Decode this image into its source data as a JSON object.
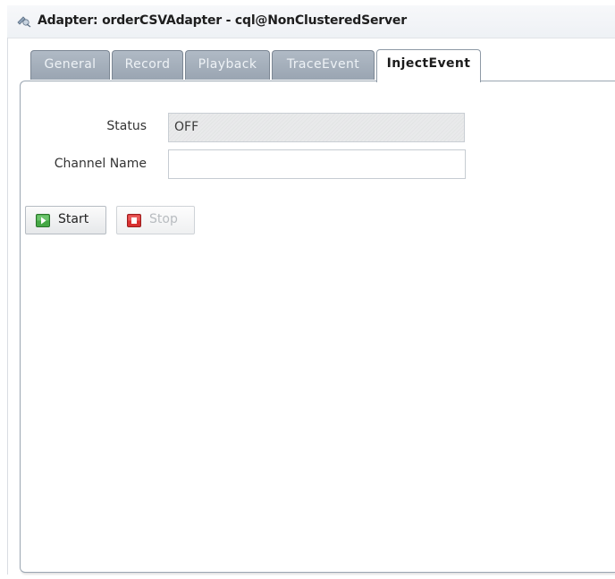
{
  "window": {
    "title": "Adapter: orderCSVAdapter - cql@NonClusteredServer",
    "icon": "adapter-icon"
  },
  "tabs": [
    {
      "label": "General",
      "active": false
    },
    {
      "label": "Record",
      "active": false
    },
    {
      "label": "Playback",
      "active": false
    },
    {
      "label": "TraceEvent",
      "active": false
    },
    {
      "label": "InjectEvent",
      "active": true
    }
  ],
  "form": {
    "status_label": "Status",
    "status_value": "OFF",
    "channel_label": "Channel Name",
    "channel_value": ""
  },
  "buttons": {
    "start_label": "Start",
    "start_icon": "play-icon",
    "stop_label": "Stop",
    "stop_icon": "stop-icon",
    "stop_disabled": true
  },
  "colors": {
    "tab_inactive": "#9aa5b2",
    "start_icon": "#3a9a3a",
    "stop_icon": "#d42a2a"
  }
}
